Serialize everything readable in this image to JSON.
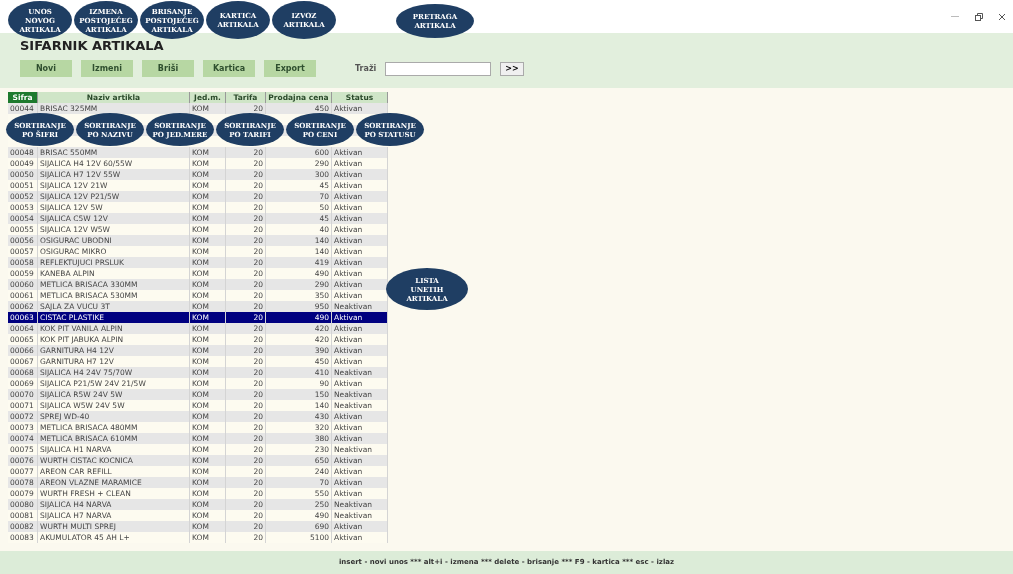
{
  "title": "SIFARNIK ARTIKALA",
  "toolbar": [
    "Novi",
    "Izmeni",
    "Briši",
    "Kartica",
    "Export"
  ],
  "search": {
    "label": "Traži",
    "button": ">>"
  },
  "columns": [
    {
      "label": "Sifra",
      "selected": true
    },
    {
      "label": "Naziv artikla",
      "selected": false
    },
    {
      "label": "Jed.m.",
      "selected": false
    },
    {
      "label": "Tarifa",
      "selected": false
    },
    {
      "label": "Prodajna cena",
      "selected": false
    },
    {
      "label": "Status",
      "selected": false
    }
  ],
  "rows": [
    {
      "kind": "row",
      "code": "00044",
      "name": "BRISAC 325MM",
      "unit": "KOM",
      "tariff": "20",
      "price": "450",
      "status": "Aktivan",
      "selected": false
    },
    {
      "kind": "covered"
    },
    {
      "kind": "covered"
    },
    {
      "kind": "covered"
    },
    {
      "kind": "row",
      "code": "00048",
      "name": "BRISAC 550MM",
      "unit": "KOM",
      "tariff": "20",
      "price": "600",
      "status": "Aktivan",
      "selected": false
    },
    {
      "kind": "row",
      "code": "00049",
      "name": "SIJALICA H4 12V 60/55W",
      "unit": "KOM",
      "tariff": "20",
      "price": "290",
      "status": "Aktivan",
      "selected": false
    },
    {
      "kind": "row",
      "code": "00050",
      "name": "SIJALICA H7 12V 55W",
      "unit": "KOM",
      "tariff": "20",
      "price": "300",
      "status": "Aktivan",
      "selected": false
    },
    {
      "kind": "row",
      "code": "00051",
      "name": "SIJALICA 12V 21W",
      "unit": "KOM",
      "tariff": "20",
      "price": "45",
      "status": "Aktivan",
      "selected": false
    },
    {
      "kind": "row",
      "code": "00052",
      "name": "SIJALICA 12V P21/5W",
      "unit": "KOM",
      "tariff": "20",
      "price": "70",
      "status": "Aktivan",
      "selected": false
    },
    {
      "kind": "row",
      "code": "00053",
      "name": "SIJALICA 12V 5W",
      "unit": "KOM",
      "tariff": "20",
      "price": "50",
      "status": "Aktivan",
      "selected": false
    },
    {
      "kind": "row",
      "code": "00054",
      "name": "SIJALICA C5W 12V",
      "unit": "KOM",
      "tariff": "20",
      "price": "45",
      "status": "Aktivan",
      "selected": false
    },
    {
      "kind": "row",
      "code": "00055",
      "name": "SIJALICA 12V W5W",
      "unit": "KOM",
      "tariff": "20",
      "price": "40",
      "status": "Aktivan",
      "selected": false
    },
    {
      "kind": "row",
      "code": "00056",
      "name": "OSIGURAC UBODNI",
      "unit": "KOM",
      "tariff": "20",
      "price": "140",
      "status": "Aktivan",
      "selected": false
    },
    {
      "kind": "row",
      "code": "00057",
      "name": "OSIGURAC MIKRO",
      "unit": "KOM",
      "tariff": "20",
      "price": "140",
      "status": "Aktivan",
      "selected": false
    },
    {
      "kind": "row",
      "code": "00058",
      "name": "REFLEKTUJUCI PRSLUK",
      "unit": "KOM",
      "tariff": "20",
      "price": "419",
      "status": "Aktivan",
      "selected": false
    },
    {
      "kind": "row",
      "code": "00059",
      "name": "KANEBA ALPIN",
      "unit": "KOM",
      "tariff": "20",
      "price": "490",
      "status": "Aktivan",
      "selected": false
    },
    {
      "kind": "row",
      "code": "00060",
      "name": "METLICA BRISACA 330MM",
      "unit": "KOM",
      "tariff": "20",
      "price": "290",
      "status": "Aktivan",
      "selected": false
    },
    {
      "kind": "row",
      "code": "00061",
      "name": "METLICA BRISACA 530MM",
      "unit": "KOM",
      "tariff": "20",
      "price": "350",
      "status": "Aktivan",
      "selected": false
    },
    {
      "kind": "row",
      "code": "00062",
      "name": "SAJLA ZA VUCU 3T",
      "unit": "KOM",
      "tariff": "20",
      "price": "950",
      "status": "Neaktivan",
      "selected": false
    },
    {
      "kind": "row",
      "code": "00063",
      "name": "CISTAC PLASTIKE",
      "unit": "KOM",
      "tariff": "20",
      "price": "490",
      "status": "Aktivan",
      "selected": true
    },
    {
      "kind": "row",
      "code": "00064",
      "name": "KOK PIT VANILA ALPIN",
      "unit": "KOM",
      "tariff": "20",
      "price": "420",
      "status": "Aktivan",
      "selected": false
    },
    {
      "kind": "row",
      "code": "00065",
      "name": "KOK PIT JABUKA ALPIN",
      "unit": "KOM",
      "tariff": "20",
      "price": "420",
      "status": "Aktivan",
      "selected": false
    },
    {
      "kind": "row",
      "code": "00066",
      "name": "GARNITURA H4 12V",
      "unit": "KOM",
      "tariff": "20",
      "price": "390",
      "status": "Aktivan",
      "selected": false
    },
    {
      "kind": "row",
      "code": "00067",
      "name": "GARNITURA H7 12V",
      "unit": "KOM",
      "tariff": "20",
      "price": "450",
      "status": "Aktivan",
      "selected": false
    },
    {
      "kind": "row",
      "code": "00068",
      "name": "SIJALICA H4 24V 75/70W",
      "unit": "KOM",
      "tariff": "20",
      "price": "410",
      "status": "Neaktivan",
      "selected": false
    },
    {
      "kind": "row",
      "code": "00069",
      "name": "SIJALICA P21/5W 24V 21/5W",
      "unit": "KOM",
      "tariff": "20",
      "price": "90",
      "status": "Aktivan",
      "selected": false
    },
    {
      "kind": "row",
      "code": "00070",
      "name": "SIJALICA R5W 24V 5W",
      "unit": "KOM",
      "tariff": "20",
      "price": "150",
      "status": "Neaktivan",
      "selected": false
    },
    {
      "kind": "row",
      "code": "00071",
      "name": "SIJALICA W5W 24V 5W",
      "unit": "KOM",
      "tariff": "20",
      "price": "140",
      "status": "Neaktivan",
      "selected": false
    },
    {
      "kind": "row",
      "code": "00072",
      "name": "SPREJ WD-40",
      "unit": "KOM",
      "tariff": "20",
      "price": "430",
      "status": "Aktivan",
      "selected": false
    },
    {
      "kind": "row",
      "code": "00073",
      "name": "METLICA BRISACA 480MM",
      "unit": "KOM",
      "tariff": "20",
      "price": "320",
      "status": "Aktivan",
      "selected": false
    },
    {
      "kind": "row",
      "code": "00074",
      "name": "METLICA BRISACA 610MM",
      "unit": "KOM",
      "tariff": "20",
      "price": "380",
      "status": "Aktivan",
      "selected": false
    },
    {
      "kind": "row",
      "code": "00075",
      "name": "SIJALICA H1 NARVA",
      "unit": "KOM",
      "tariff": "20",
      "price": "230",
      "status": "Neaktivan",
      "selected": false
    },
    {
      "kind": "row",
      "code": "00076",
      "name": "WURTH CISTAC KOCNICA",
      "unit": "KOM",
      "tariff": "20",
      "price": "650",
      "status": "Aktivan",
      "selected": false
    },
    {
      "kind": "row",
      "code": "00077",
      "name": "AREON CAR REFILL",
      "unit": "KOM",
      "tariff": "20",
      "price": "240",
      "status": "Aktivan",
      "selected": false
    },
    {
      "kind": "row",
      "code": "00078",
      "name": "AREON VLAZNE MARAMICE",
      "unit": "KOM",
      "tariff": "20",
      "price": "70",
      "status": "Aktivan",
      "selected": false
    },
    {
      "kind": "row",
      "code": "00079",
      "name": "WURTH FRESH + CLEAN",
      "unit": "KOM",
      "tariff": "20",
      "price": "550",
      "status": "Aktivan",
      "selected": false
    },
    {
      "kind": "row",
      "code": "00080",
      "name": "SIJALICA H4 NARVA",
      "unit": "KOM",
      "tariff": "20",
      "price": "250",
      "status": "Neaktivan",
      "selected": false
    },
    {
      "kind": "row",
      "code": "00081",
      "name": "SIJALICA H7 NARVA",
      "unit": "KOM",
      "tariff": "20",
      "price": "490",
      "status": "Neaktivan",
      "selected": false
    },
    {
      "kind": "row",
      "code": "00082",
      "name": "WURTH MULTI SPREJ",
      "unit": "KOM",
      "tariff": "20",
      "price": "690",
      "status": "Aktivan",
      "selected": false
    },
    {
      "kind": "row",
      "code": "00083",
      "name": "AKUMULATOR 45 AH L+",
      "unit": "KOM",
      "tariff": "20",
      "price": "5100",
      "status": "Aktivan",
      "selected": false
    }
  ],
  "footer": "insert - novi unos *** alt+i - izmena *** delete - brisanje *** F9 - kartica *** esc - izlaz",
  "callouts_top": [
    [
      "UNOS",
      "NOVOG",
      "ARTIKALA"
    ],
    [
      "IZMENA",
      "POSTOJEĆEG",
      "ARTIKALA"
    ],
    [
      "BRISANJE",
      "POSTOJEĆEG",
      "ARTIKALA"
    ],
    [
      "KARTICA",
      "ARTIKALA"
    ],
    [
      "IZVOZ",
      "ARTIKALA"
    ]
  ],
  "callout_search": [
    "PRETRAGA",
    "ARTIKALA"
  ],
  "callouts_sort": [
    [
      "SORTIRANJE",
      "PO ŠIFRI"
    ],
    [
      "SORTIRANJE",
      "PO NAZIVU"
    ],
    [
      "SORTIRANJE",
      "PO JED.MERE"
    ],
    [
      "SORTIRANJE",
      "PO TARIFI"
    ],
    [
      "SORTIRANJE",
      "PO CENI"
    ],
    [
      "SORTIRANJE",
      "PO STATUSU"
    ]
  ],
  "callout_list": [
    "LISTA",
    "UNETIH",
    "ARTIKALA"
  ]
}
